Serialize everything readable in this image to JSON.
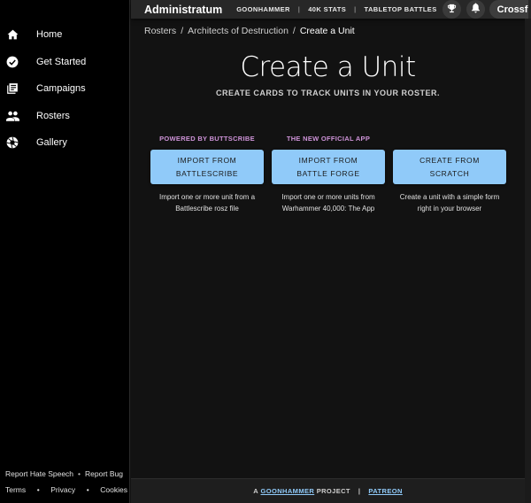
{
  "app": {
    "title": "Administratum"
  },
  "topbar": {
    "links": [
      "GOONHAMMER",
      "40K STATS",
      "TABLETOP BATTLES"
    ],
    "user_label": "Crossfire"
  },
  "sidebar": {
    "items": [
      {
        "label": "Home",
        "icon": "home-icon"
      },
      {
        "label": "Get Started",
        "icon": "check-circle-icon"
      },
      {
        "label": "Campaigns",
        "icon": "library-icon"
      },
      {
        "label": "Rosters",
        "icon": "group-icon"
      },
      {
        "label": "Gallery",
        "icon": "aperture-icon"
      }
    ],
    "footer": {
      "report_hate": "Report Hate Speech",
      "report_bug": "Report Bug",
      "terms": "Terms",
      "privacy": "Privacy",
      "cookies": "Cookies"
    }
  },
  "breadcrumb": {
    "items": [
      "Rosters",
      "Architects of Destruction"
    ],
    "current": "Create a Unit"
  },
  "main": {
    "title": "Create a Unit",
    "subtitle": "CREATE CARDS TO TRACK UNITS IN YOUR ROSTER."
  },
  "options": [
    {
      "tag": "POWERED BY BUTTSCRIBE",
      "line1": "IMPORT FROM",
      "line2": "BATTLESCRIBE",
      "desc1": "Import one or more unit from a",
      "desc2": "Battlescribe rosz file"
    },
    {
      "tag": "THE NEW OFFICIAL APP",
      "line1": "IMPORT FROM",
      "line2": "BATTLE FORGE",
      "desc1": "Import one or more units from",
      "desc2": "Warhammer 40,000: The App"
    },
    {
      "tag": "",
      "line1": "CREATE FROM",
      "line2": "SCRATCH",
      "desc1": "Create a unit with a simple form",
      "desc2": "right in your browser"
    }
  ],
  "footer": {
    "prefix": "A",
    "link": "GOONHAMMER",
    "suffix": "PROJECT",
    "patreon": "PATREON"
  },
  "colors": {
    "accent": "#90caf9",
    "tag": "#ce93d8",
    "background": "#121212"
  }
}
